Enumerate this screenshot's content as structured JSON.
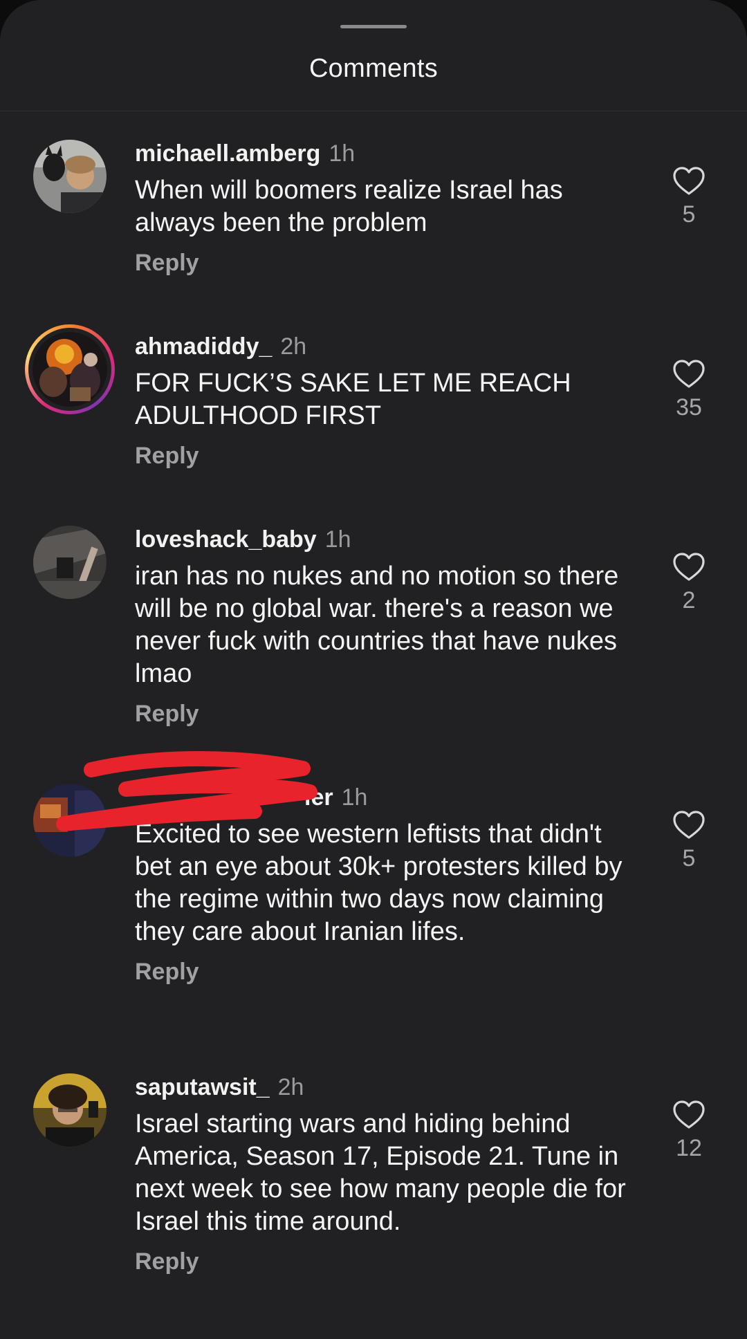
{
  "sheet": {
    "title": "Comments"
  },
  "comments": [
    {
      "username": "michaell.amberg",
      "time": "1h",
      "text": "When will boomers realize Israel has always been the problem",
      "reply_label": "Reply",
      "likes": "5",
      "avatar_style": "plain"
    },
    {
      "username": "ahmadiddy_",
      "time": "2h",
      "text": "FOR FUCK’S SAKE LET ME REACH ADULTHOOD FIRST",
      "reply_label": "Reply",
      "likes": "35",
      "avatar_style": "story-ring"
    },
    {
      "username": "loveshack_baby",
      "time": "1h",
      "text": "iran has no nukes and no motion so there will be no global war. there's a reason we never fuck with countries that have nukes lmao",
      "reply_label": "Reply",
      "likes": "2",
      "avatar_style": "plain"
    },
    {
      "username": "ier",
      "time": "1h",
      "text": "Excited to see western leftists that didn't bet an eye about 30k+ protesters killed by the regime within two days now claiming they care about Iranian lifes.",
      "reply_label": "Reply",
      "likes": "5",
      "avatar_style": "plain",
      "username_redacted": true
    },
    {
      "username": "saputawsit_",
      "time": "2h",
      "text": "Israel starting wars and hiding behind America, Season 17, Episode 21. Tune in next week to see how many people die for Israel this time around.",
      "reply_label": "Reply",
      "likes": "12",
      "avatar_style": "plain"
    }
  ],
  "icons": {
    "like": "heart-outline-icon"
  },
  "colors": {
    "background": "#212124",
    "text_primary": "#f5f5f5",
    "text_secondary": "#9a9a9f",
    "redaction": "#e8232b",
    "story_ring": "#dd2a7b"
  }
}
